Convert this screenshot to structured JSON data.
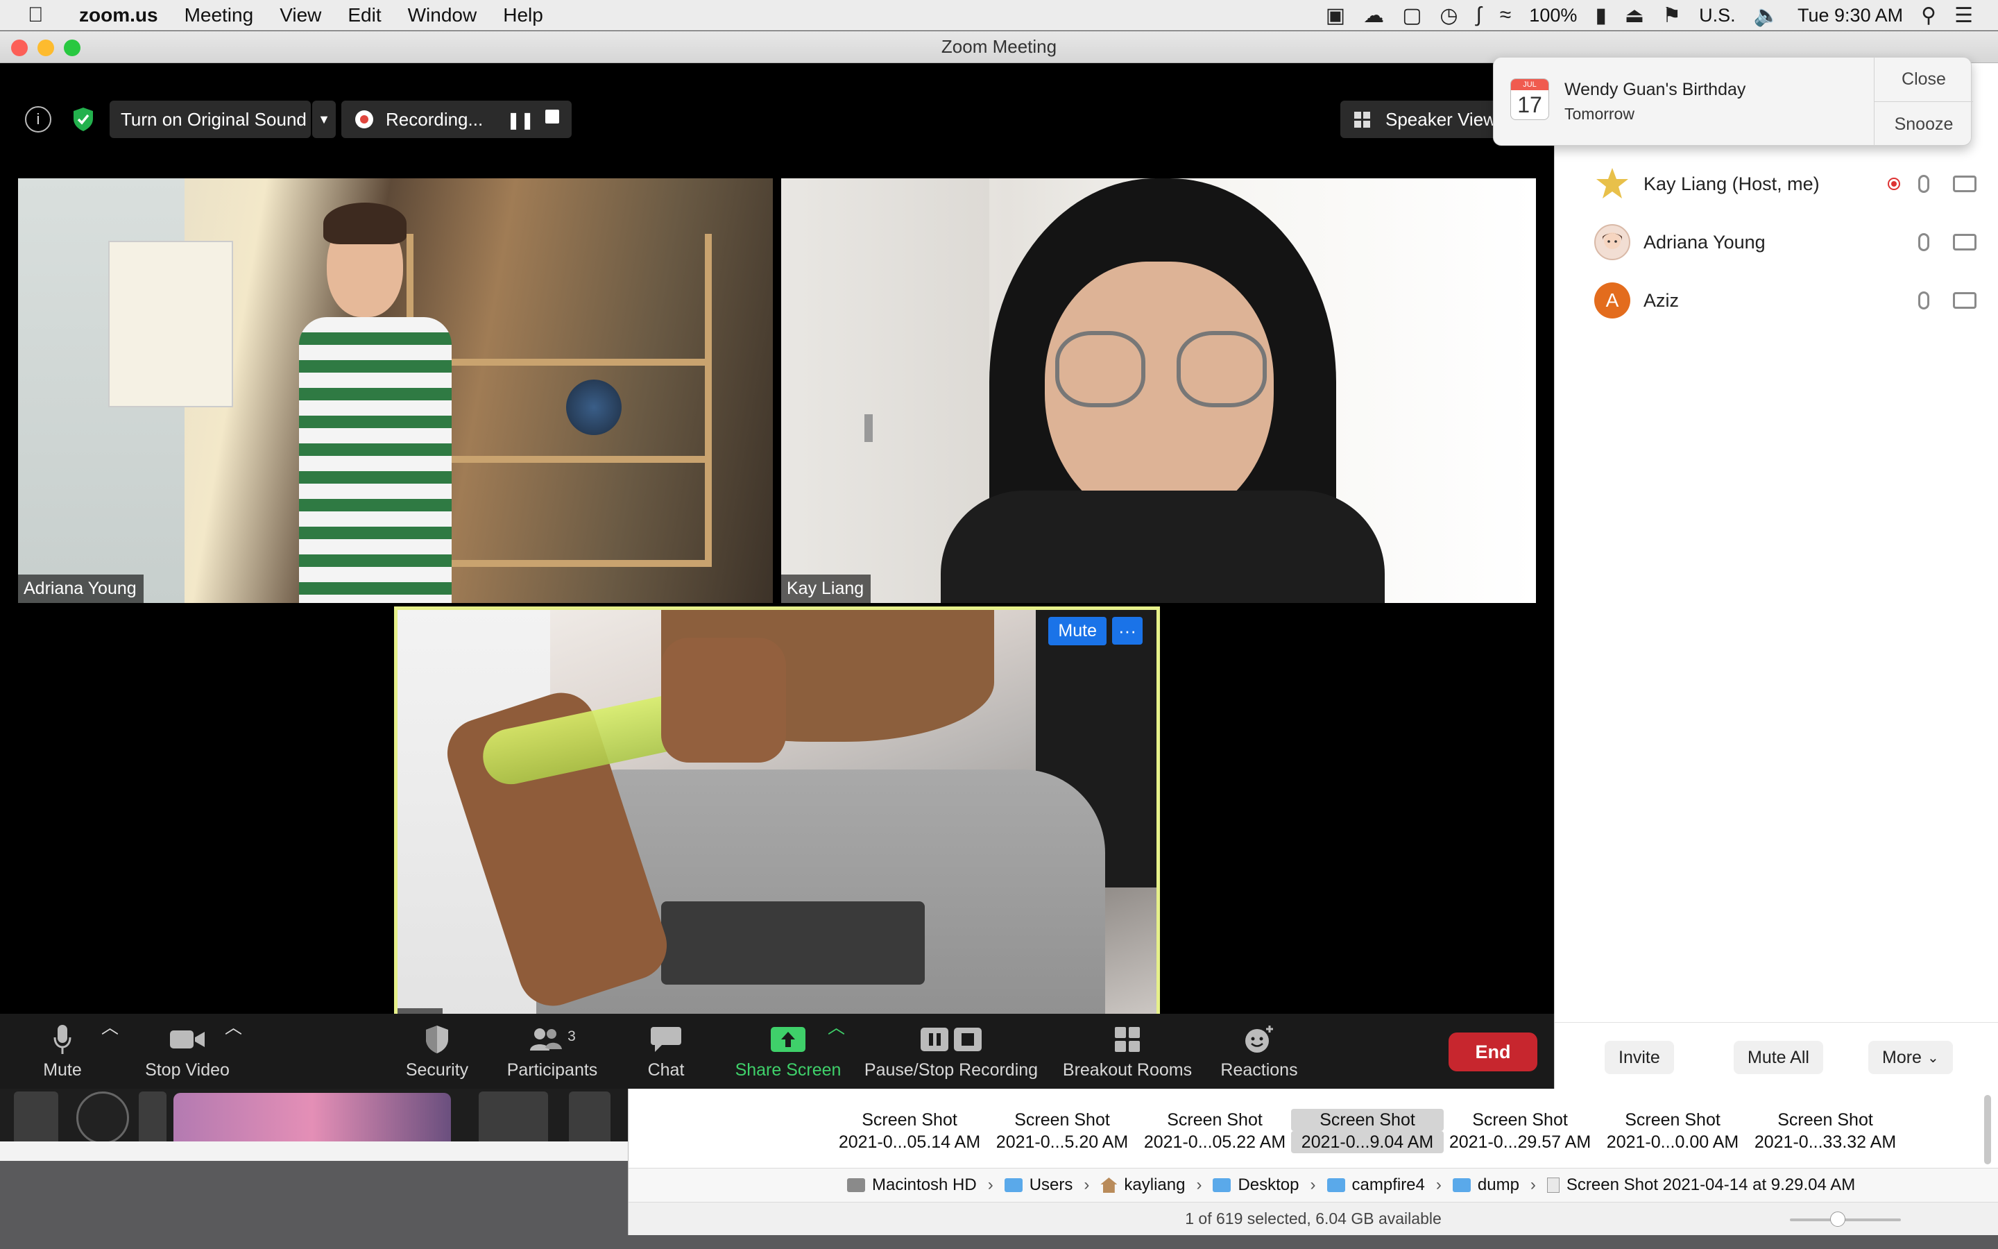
{
  "menubar": {
    "app_name": "zoom.us",
    "items": [
      "Meeting",
      "View",
      "Edit",
      "Window",
      "Help"
    ],
    "battery": "100%",
    "input_source": "U.S.",
    "clock": "Tue 9:30 AM"
  },
  "window": {
    "title": "Zoom Meeting"
  },
  "topbar": {
    "original_sound_label": "Turn on Original Sound",
    "recording_label": "Recording...",
    "view_label": "Speaker View"
  },
  "notification": {
    "title": "Wendy Guan's Birthday",
    "subtitle": "Tomorrow",
    "calendar_month": "JUL",
    "calendar_day": "17",
    "close_label": "Close",
    "snooze_label": "Snooze"
  },
  "tiles": {
    "adriana_name": "Adriana Young",
    "kay_name": "Kay Liang",
    "aziz_name": "Aziz",
    "aziz_mute_label": "Mute",
    "aziz_more_label": "···"
  },
  "toolbar": {
    "mute_label": "Mute",
    "stop_video_label": "Stop Video",
    "security_label": "Security",
    "participants_label": "Participants",
    "participants_count": "3",
    "chat_label": "Chat",
    "share_screen_label": "Share Screen",
    "recording_label": "Pause/Stop Recording",
    "breakout_label": "Breakout Rooms",
    "reactions_label": "Reactions",
    "end_label": "End"
  },
  "participants": [
    {
      "name": "Kay Liang (Host, me)",
      "initial": "",
      "color": "#e8c04a"
    },
    {
      "name": "Adriana Young",
      "initial": "",
      "color": "#c98a7a"
    },
    {
      "name": "Aziz",
      "initial": "A",
      "color": "#e36c1d"
    }
  ],
  "panel_footer": {
    "invite_label": "Invite",
    "mute_all_label": "Mute All",
    "more_label": "More"
  },
  "finder": {
    "files": [
      {
        "name": "Screen Shot",
        "sub": "2021-0...05.14 AM"
      },
      {
        "name": "Screen Shot",
        "sub": "2021-0...5.20 AM"
      },
      {
        "name": "Screen Shot",
        "sub": "2021-0...05.22 AM"
      },
      {
        "name": "Screen Shot",
        "sub": "2021-0...9.04 AM"
      },
      {
        "name": "Screen Shot",
        "sub": "2021-0...29.57 AM"
      },
      {
        "name": "Screen Shot",
        "sub": "2021-0...0.00 AM"
      },
      {
        "name": "Screen Shot",
        "sub": "2021-0...33.32 AM"
      }
    ],
    "path": [
      "Macintosh HD",
      "Users",
      "kayliang",
      "Desktop",
      "campfire4",
      "dump",
      "Screen Shot 2021-04-14 at 9.29.04 AM"
    ],
    "status": "1 of 619 selected, 6.04 GB available"
  },
  "colors": {
    "accent_blue": "#1a73e8",
    "end_red": "#c7262e",
    "share_green": "#3fd06a",
    "active_speaker_border": "#e6f08a"
  }
}
